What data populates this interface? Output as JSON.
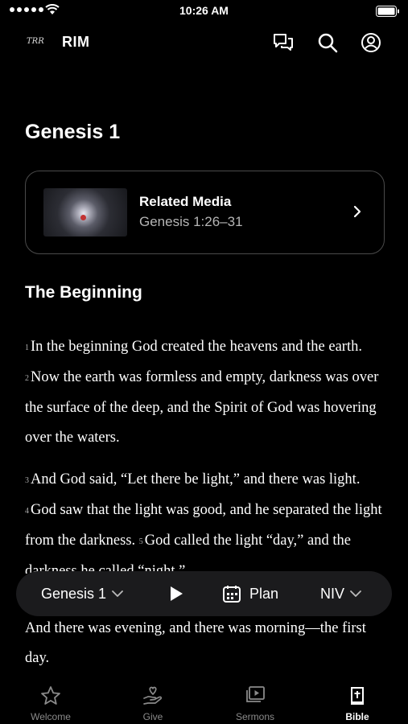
{
  "status": {
    "time": "10:26 AM"
  },
  "header": {
    "logo_text": "TRR",
    "title": "RIM"
  },
  "page": {
    "title": "Genesis 1"
  },
  "related_media": {
    "heading": "Related Media",
    "reference": "Genesis 1:26–31"
  },
  "section": {
    "heading": "The Beginning"
  },
  "verses": {
    "v1": "In the beginning God created the heavens and the earth.",
    "v2": "Now the earth was formless and empty, darkness was over the surface of the deep, and the Spirit of God was hovering over the waters.",
    "v3": "And God said, “Let there be light,” and there was light.",
    "v4": "God saw that the light was good, and he separated the light from the darkness.",
    "v5": "God called the light “day,” and the darkness he called “night.”",
    "v5b": "And there was evening, and there was morning—the first day."
  },
  "reader_bar": {
    "chapter": "Genesis 1",
    "plan": "Plan",
    "version": "NIV"
  },
  "tabs": [
    {
      "label": "Welcome",
      "icon": "star-icon"
    },
    {
      "label": "Give",
      "icon": "give-hand-icon"
    },
    {
      "label": "Sermons",
      "icon": "sermons-video-icon"
    },
    {
      "label": "Bible",
      "icon": "bible-icon"
    }
  ],
  "colors": {
    "background": "#000000",
    "card_border": "#4a4a4a",
    "toolbar_bg": "#1b1b1d",
    "muted_text": "#b5b5b5",
    "inactive_tab": "#8a8a8a"
  }
}
